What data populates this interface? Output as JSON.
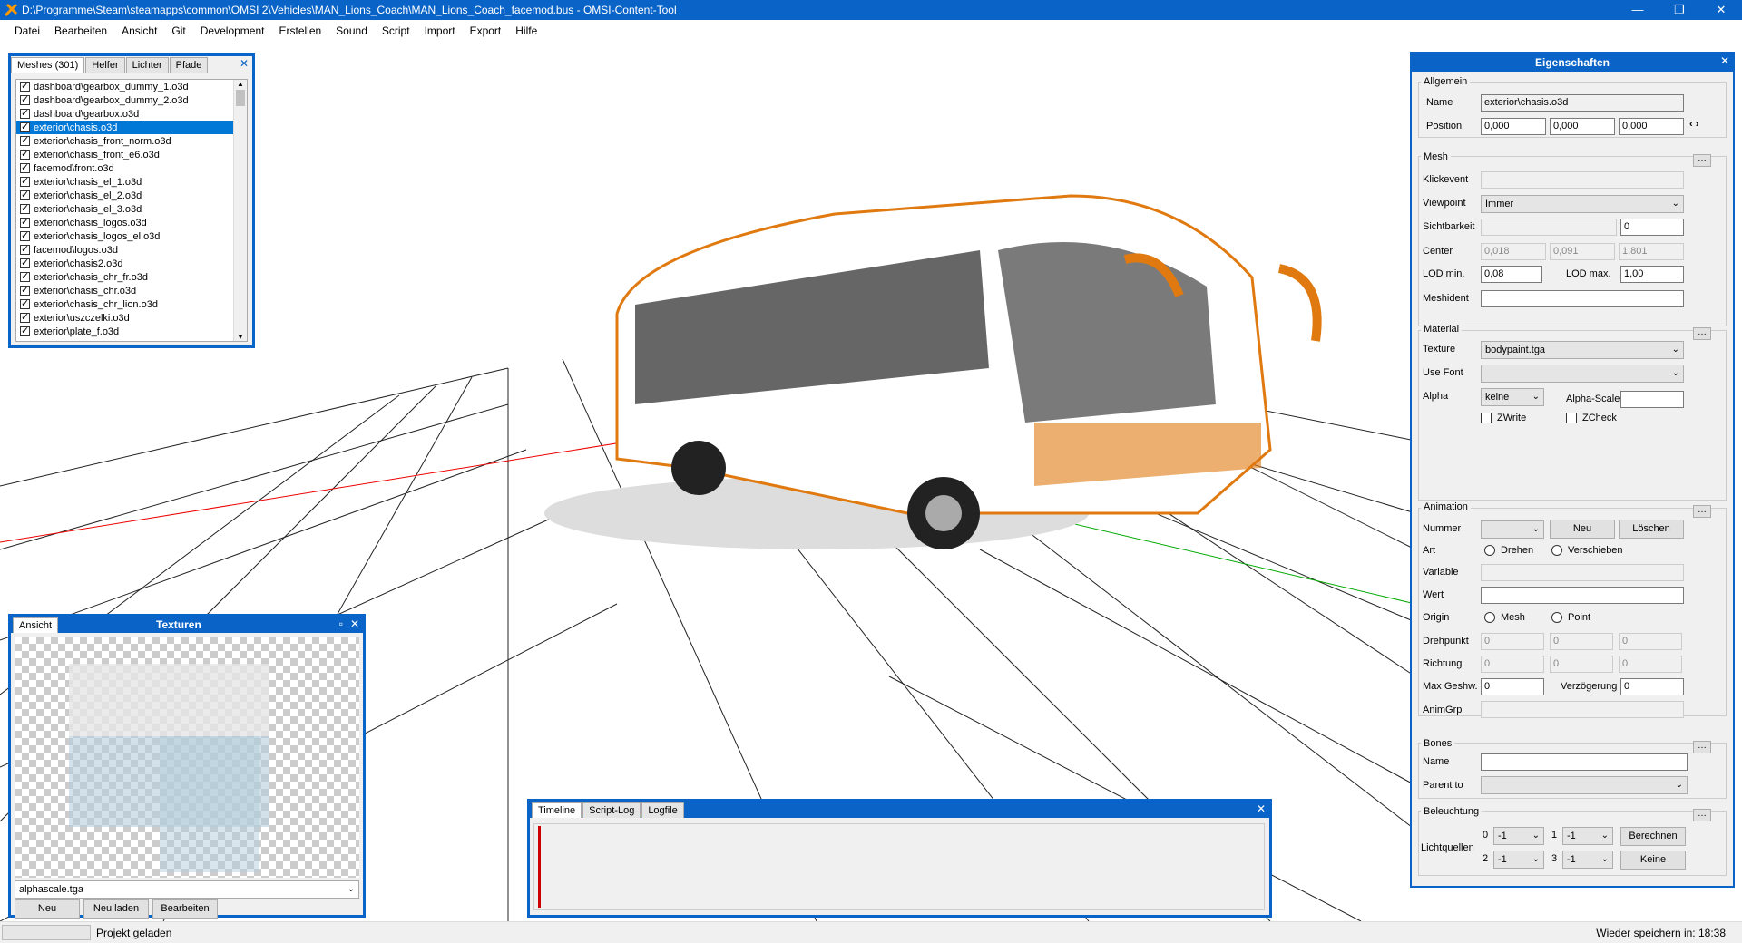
{
  "window": {
    "title": "D:\\Programme\\Steam\\steamapps\\common\\OMSI 2\\Vehicles\\MAN_Lions_Coach\\MAN_Lions_Coach_facemod.bus - OMSI-Content-Tool",
    "min": "—",
    "max": "❐",
    "close": "✕"
  },
  "menu": [
    "Datei",
    "Bearbeiten",
    "Ansicht",
    "Git",
    "Development",
    "Erstellen",
    "Sound",
    "Script",
    "Import",
    "Export",
    "Hilfe"
  ],
  "meshes_panel": {
    "tabs": [
      "Meshes (301)",
      "Helfer",
      "Lichter",
      "Pfade"
    ],
    "items": [
      {
        "label": "dashboard\\gearbox_dummy_1.o3d",
        "checked": true
      },
      {
        "label": "dashboard\\gearbox_dummy_2.o3d",
        "checked": true
      },
      {
        "label": "dashboard\\gearbox.o3d",
        "checked": true
      },
      {
        "label": "exterior\\chasis.o3d",
        "checked": true,
        "selected": true
      },
      {
        "label": "exterior\\chasis_front_norm.o3d",
        "checked": true
      },
      {
        "label": "exterior\\chasis_front_e6.o3d",
        "checked": true
      },
      {
        "label": "facemod\\front.o3d",
        "checked": true
      },
      {
        "label": "exterior\\chasis_el_1.o3d",
        "checked": true
      },
      {
        "label": "exterior\\chasis_el_2.o3d",
        "checked": true
      },
      {
        "label": "exterior\\chasis_el_3.o3d",
        "checked": true
      },
      {
        "label": "exterior\\chasis_logos.o3d",
        "checked": true
      },
      {
        "label": "exterior\\chasis_logos_el.o3d",
        "checked": true
      },
      {
        "label": "facemod\\logos.o3d",
        "checked": true
      },
      {
        "label": "exterior\\chasis2.o3d",
        "checked": true
      },
      {
        "label": "exterior\\chasis_chr_fr.o3d",
        "checked": true
      },
      {
        "label": "exterior\\chasis_chr.o3d",
        "checked": true
      },
      {
        "label": "exterior\\chasis_chr_lion.o3d",
        "checked": true
      },
      {
        "label": "exterior\\uszczelki.o3d",
        "checked": true
      },
      {
        "label": "exterior\\plate_f.o3d",
        "checked": true
      }
    ]
  },
  "textures_panel": {
    "tab": "Ansicht",
    "title": "Texturen",
    "selected": "alphascale.tga",
    "buttons": [
      "Neu",
      "Neu laden",
      "Bearbeiten"
    ]
  },
  "timeline_panel": {
    "tabs": [
      "Timeline",
      "Script-Log",
      "Logfile"
    ]
  },
  "properties": {
    "title": "Eigenschaften",
    "allgemein": {
      "title": "Allgemein",
      "name_label": "Name",
      "name": "exterior\\chasis.o3d",
      "position_label": "Position",
      "pos": [
        "0,000",
        "0,000",
        "0,000"
      ]
    },
    "mesh": {
      "title": "Mesh",
      "klickevent": "Klickevent",
      "viewpoint": "Viewpoint",
      "viewpoint_val": "Immer",
      "sichtbarkeit": "Sichtbarkeit",
      "sichtbarkeit_val": "0",
      "center": "Center",
      "center_vals": [
        "0,018",
        "0,091",
        "1,801"
      ],
      "lod_min": "LOD min.",
      "lod_min_val": "0,08",
      "lod_max": "LOD max.",
      "lod_max_val": "1,00",
      "meshident": "Meshident"
    },
    "material": {
      "title": "Material",
      "texture": "Texture",
      "texture_val": "bodypaint.tga",
      "usefont": "Use Font",
      "alpha": "Alpha",
      "alpha_val": "keine",
      "alphascale": "Alpha-Scale",
      "zwrite": "ZWrite",
      "zcheck": "ZCheck"
    },
    "animation": {
      "title": "Animation",
      "nummer": "Nummer",
      "neu": "Neu",
      "loeschen": "Löschen",
      "art": "Art",
      "drehen": "Drehen",
      "verschieben": "Verschieben",
      "variable": "Variable",
      "wert": "Wert",
      "origin": "Origin",
      "mesh": "Mesh",
      "point": "Point",
      "drehpunkt": "Drehpunkt",
      "drehpunkt_vals": [
        "0",
        "0",
        "0"
      ],
      "richtung": "Richtung",
      "richtung_vals": [
        "0",
        "0",
        "0"
      ],
      "maxgeshw": "Max Geshw.",
      "maxgeshw_val": "0",
      "verzoegerung": "Verzögerung",
      "verzoegerung_val": "0",
      "animgrp": "AnimGrp"
    },
    "bones": {
      "title": "Bones",
      "name": "Name",
      "parent": "Parent to"
    },
    "beleuchtung": {
      "title": "Beleuchtung",
      "lichtquellen": "Lichtquellen",
      "idx": [
        "0",
        "1",
        "2",
        "3"
      ],
      "vals": [
        "-1",
        "-1",
        "-1",
        "-1"
      ],
      "berechnen": "Berechnen",
      "keine": "Keine"
    }
  },
  "status": {
    "left": "Projekt geladen",
    "right": "Wieder speichern in: 18:38"
  }
}
